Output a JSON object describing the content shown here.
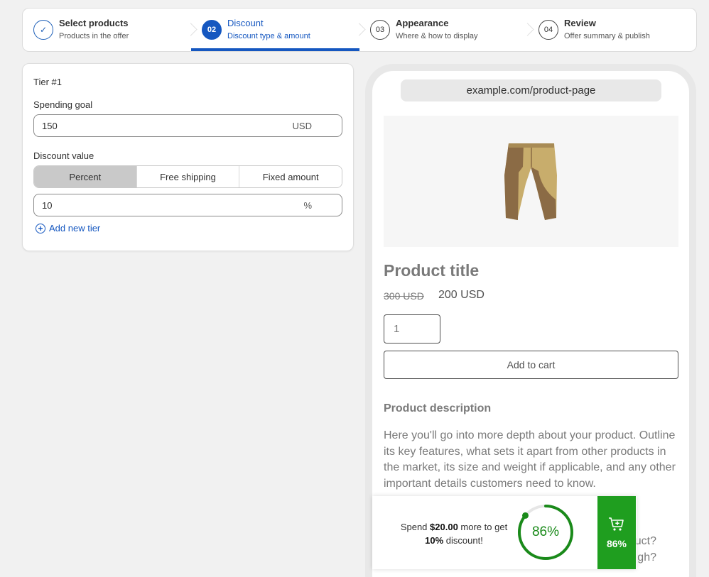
{
  "stepper": {
    "steps": [
      {
        "badge": "✓",
        "title": "Select products",
        "subtitle": "Products in the offer"
      },
      {
        "badge": "02",
        "title": "Discount",
        "subtitle": "Discount type & amount"
      },
      {
        "badge": "03",
        "title": "Appearance",
        "subtitle": "Where & how to display"
      },
      {
        "badge": "04",
        "title": "Review",
        "subtitle": "Offer summary & publish"
      }
    ]
  },
  "tier": {
    "title": "Tier #1",
    "spending_goal_label": "Spending goal",
    "spending_goal_value": "150",
    "spending_goal_currency": "USD",
    "discount_value_label": "Discount value",
    "discount_types": [
      "Percent",
      "Free shipping",
      "Fixed amount"
    ],
    "discount_value": "10",
    "discount_suffix": "%",
    "add_tier_label": "Add new tier"
  },
  "preview": {
    "url": "example.com/product-page",
    "product_title": "Product title",
    "old_price": "300 USD",
    "new_price": "200 USD",
    "quantity": "1",
    "add_to_cart": "Add to cart",
    "description_heading": "Product description",
    "description": "Here you'll go into more depth about your product. Outline its key features, what sets it apart from other products in the market, its size and weight if applicable, and any other important details customers need to know.",
    "description_tail": "uct? gh?"
  },
  "popup": {
    "text_prefix": "Spend",
    "amount": "$20.00",
    "text_mid": "more to get",
    "discount": "10%",
    "text_suffix": "discount!",
    "progress_label": "86%",
    "progress_value": 0.86,
    "cart_percent": "86%",
    "accent_color": "#1f9e1f"
  }
}
